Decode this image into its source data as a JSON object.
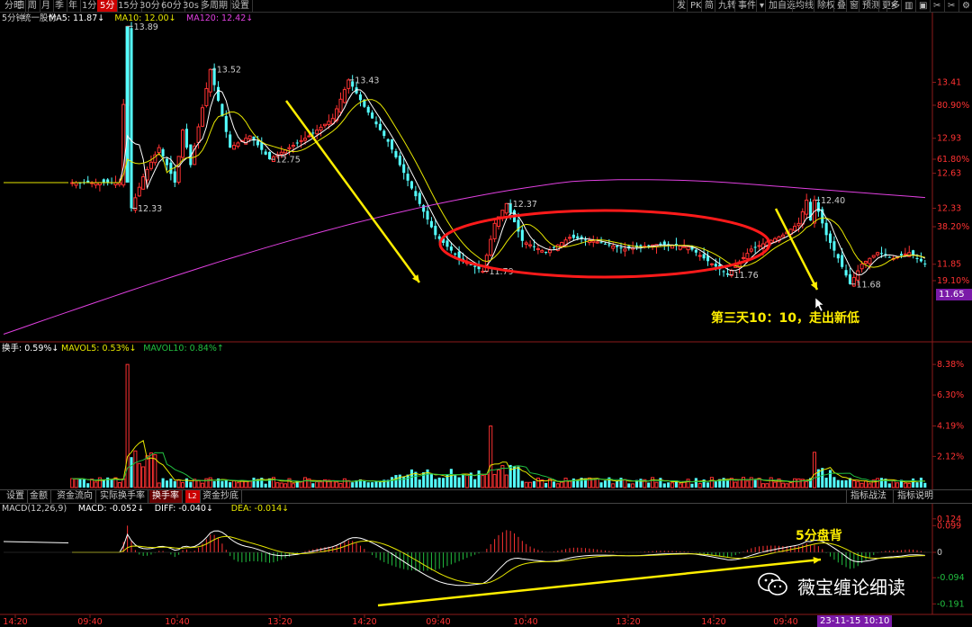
{
  "toolbar": {
    "left": [
      "分时",
      "日",
      "周",
      "月",
      "季",
      "年",
      "1分",
      "5分",
      "15分",
      "30分",
      "60分",
      "30s",
      "多周期",
      "设置"
    ],
    "active": "5分",
    "right": [
      "发",
      "PK",
      "简",
      "九转",
      "事件",
      "▾",
      "加自选",
      "均线",
      "除权",
      "叠",
      "窗",
      "预测",
      "更多"
    ],
    "icons": [
      "close-icon",
      "bars-icon",
      "lock-icon",
      "scissors-icon",
      "scissors-icon",
      "settings-icon"
    ]
  },
  "main_legend": [
    {
      "text": "5分钟",
      "color": "#cccccc"
    },
    {
      "text": "统一股份",
      "color": "#cccccc"
    },
    {
      "text": "MA5: 11.87↓",
      "color": "#ffffff"
    },
    {
      "text": "MA10: 12.00↓",
      "color": "#e6e600"
    },
    {
      "text": "MA120: 12.42↓",
      "color": "#e040e0"
    }
  ],
  "vol_legend": [
    {
      "text": "换手: 0.59%↓",
      "color": "#ffffff"
    },
    {
      "text": "MAVOL5: 0.53%↓",
      "color": "#e6e600"
    },
    {
      "text": "MAVOL10: 0.84%↑",
      "color": "#22c040"
    }
  ],
  "tabs": {
    "items": [
      "设置",
      "金额",
      "资金流向",
      "实际换手率",
      "换手率",
      "资金抄底"
    ],
    "active": "换手率",
    "badge": "L2",
    "right": [
      "指标战法",
      "指标说明"
    ]
  },
  "macd_legend": [
    {
      "text": "MACD(12,26,9)",
      "color": "#cccccc"
    },
    {
      "text": "MACD: -0.052↓",
      "color": "#ffffff"
    },
    {
      "text": "DIFF: -0.040↓",
      "color": "#ffffff"
    },
    {
      "text": "DEA: -0.014↓",
      "color": "#e6e600"
    }
  ],
  "annotations": {
    "low_note": "第三天10：10，走出新低",
    "divergence": "5分盘背"
  },
  "watermark": "薇宝缠论细读",
  "colors": {
    "up": "#ff3232",
    "down": "#54ffff",
    "ma5": "#ffffff",
    "ma10": "#e6e600",
    "ma120": "#e040e0",
    "arrow": "#ffee00",
    "ellipse": "#ff1a1a",
    "current_price_bg": "#7a1aa8"
  },
  "chart_data": [
    {
      "type": "candlestick",
      "title": "统一股份 5分钟",
      "series": [
        {
          "name": "MA5",
          "last": 11.87
        },
        {
          "name": "MA10",
          "last": 12.0
        },
        {
          "name": "MA120",
          "last": 12.42
        }
      ],
      "y_ticks_right": [
        "13.41",
        "80.90%",
        "12.93",
        "61.80%",
        "12.63",
        "12.33",
        "38.20%",
        "11.85",
        "19.10%"
      ],
      "current_price": "11.65",
      "price_labels": [
        {
          "label": "13.89",
          "value": 13.89
        },
        {
          "label": "13.52",
          "value": 13.52
        },
        {
          "label": "13.43",
          "value": 13.43
        },
        {
          "label": "12.75",
          "value": 12.75
        },
        {
          "label": "12.33",
          "value": 12.33
        },
        {
          "label": "12.37",
          "value": 12.37
        },
        {
          "label": "11.79",
          "value": 11.79
        },
        {
          "label": "11.76",
          "value": 11.76
        },
        {
          "label": "12.40",
          "value": 12.4
        },
        {
          "label": "11.68",
          "value": 11.68
        }
      ],
      "x_ticks": [
        "14:20",
        "09:40",
        "10:40",
        "13:20",
        "14:20",
        "09:40",
        "10:40",
        "13:20",
        "14:20",
        "09:40",
        "10:10"
      ],
      "cursor_time": "23-11-15 10:10",
      "ylim": [
        11.2,
        14.0
      ]
    },
    {
      "type": "bar",
      "title": "换手率",
      "y_ticks_right": [
        "8.38%",
        "6.30%",
        "4.19%",
        "2.12%"
      ],
      "series": [
        {
          "name": "换手",
          "last": "0.59%"
        },
        {
          "name": "MAVOL5",
          "last": "0.53%"
        },
        {
          "name": "MAVOL10",
          "last": "0.84%"
        }
      ],
      "peaks": [
        8.38,
        2.7,
        4.19,
        1.5
      ],
      "ylim": [
        0,
        9.0
      ]
    },
    {
      "type": "bar",
      "title": "MACD(12,26,9)",
      "y_ticks_right": [
        "0.124",
        "0.099",
        "0",
        "-0.094",
        "-0.191"
      ],
      "series": [
        {
          "name": "MACD",
          "last": -0.052
        },
        {
          "name": "DIFF",
          "last": -0.04
        },
        {
          "name": "DEA",
          "last": -0.014
        }
      ],
      "ylim": [
        -0.22,
        0.14
      ]
    }
  ]
}
